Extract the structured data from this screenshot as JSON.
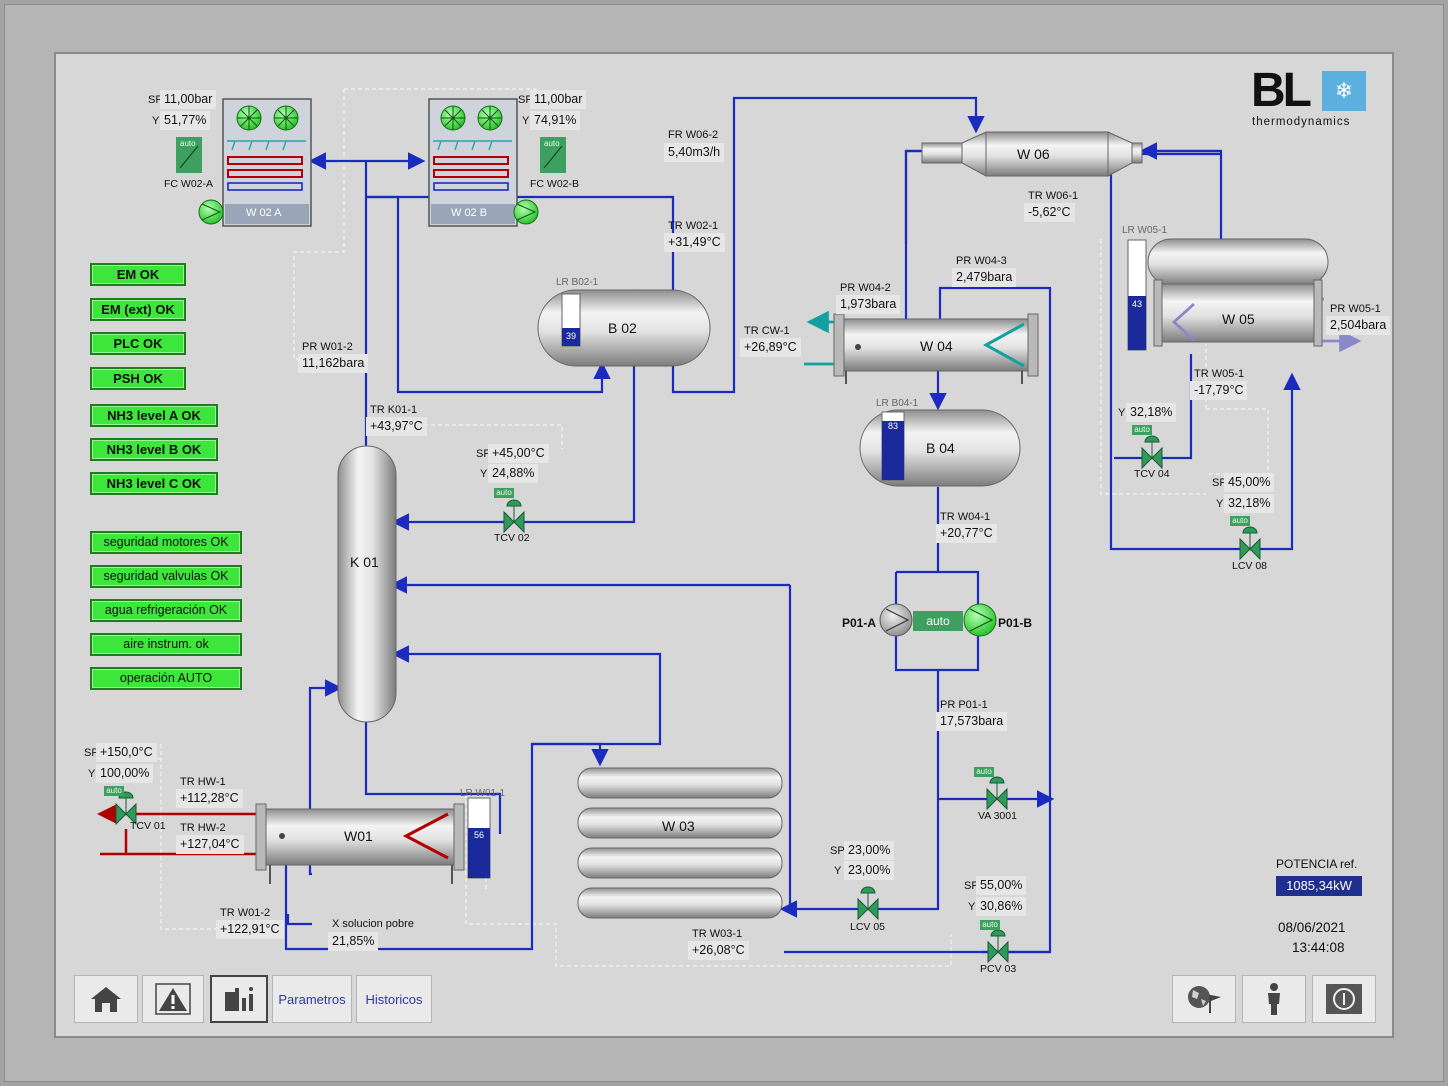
{
  "logo": {
    "letters": "BL",
    "subtitle": "thermodynamics"
  },
  "fans": {
    "w02a": {
      "name": "W 02 A",
      "sp_label": "SP",
      "sp": "11,00bar",
      "y_label": "Y",
      "y": "51,77%",
      "fc": "FC W02-A",
      "auto": "auto"
    },
    "w02b": {
      "name": "W 02 B",
      "sp_label": "SP",
      "sp": "11,00bar",
      "y_label": "Y",
      "y": "74,91%",
      "fc": "FC W02-B",
      "auto": "auto"
    }
  },
  "status": [
    "EM   OK",
    "EM (ext) OK",
    "PLC   OK",
    "PSH   OK",
    "NH3 level A OK",
    "NH3 level B OK",
    "NH3 level C OK"
  ],
  "status2": [
    "seguridad motores OK",
    "seguridad valvulas OK",
    "agua refrigeración OK",
    "aire instrum. ok",
    "operación AUTO"
  ],
  "vessels": {
    "b02": "B 02",
    "b04": "B 04",
    "w04": "W 04",
    "w05": "W 05",
    "w06": "W 06",
    "w01": "W01",
    "w03": "W 03",
    "k01": "K 01"
  },
  "levels": {
    "b02": {
      "tag": "LR B02-1",
      "value": "39"
    },
    "b04": {
      "tag": "LR B04-1",
      "value": "83"
    },
    "w05": {
      "tag": "LR W05-1",
      "value": "43"
    },
    "w01": {
      "tag": "LR W01-1",
      "value": "56"
    }
  },
  "tags": {
    "fr_w06_2": {
      "tag": "FR W06-2",
      "value": "5,40m3/h"
    },
    "tr_w02_1": {
      "tag": "TR W02-1",
      "value": "+31,49°C"
    },
    "tr_w06_1": {
      "tag": "TR W06-1",
      "value": "-5,62°C"
    },
    "pr_w01_2": {
      "tag": "PR W01-2",
      "value": "11,162bara"
    },
    "tr_k01_1": {
      "tag": "TR K01-1",
      "value": "+43,97°C"
    },
    "pr_w04_3": {
      "tag": "PR W04-3",
      "value": "2,479bara"
    },
    "pr_w04_2": {
      "tag": "PR W04-2",
      "value": "1,973bara"
    },
    "tr_cw_1": {
      "tag": "TR CW-1",
      "value": "+26,89°C"
    },
    "pr_w05_1": {
      "tag": "PR W05-1",
      "value": "2,504bara"
    },
    "tr_w05_1": {
      "tag": "TR W05-1",
      "value": "-17,79°C"
    },
    "tr_w04_1": {
      "tag": "TR W04-1",
      "value": "+20,77°C"
    },
    "pr_p01_1": {
      "tag": "PR P01-1",
      "value": "17,573bara"
    },
    "tr_hw_1": {
      "tag": "TR HW-1",
      "value": "+112,28°C"
    },
    "tr_hw_2": {
      "tag": "TR HW-2",
      "value": "+127,04°C"
    },
    "tr_w01_2": {
      "tag": "TR W01-2",
      "value": "+122,91°C"
    },
    "x_sol": {
      "tag": "X solucion pobre",
      "value": "21,85%"
    },
    "tr_w03_1": {
      "tag": "TR W03-1",
      "value": "+26,08°C"
    }
  },
  "valves": {
    "tcv02": {
      "name": "TCV 02",
      "sp_label": "SP",
      "sp": "+45,00°C",
      "y_label": "Y",
      "y": "24,88%",
      "auto": "auto"
    },
    "tcv04": {
      "name": "TCV 04",
      "y_label": "Y",
      "y": "32,18%",
      "auto": "auto"
    },
    "lcv08": {
      "name": "LCV 08",
      "sp_label": "SP",
      "sp": "45,00%",
      "y_label": "Y",
      "y": "32,18%",
      "auto": "auto"
    },
    "tcv01": {
      "name": "TCV 01",
      "sp_label": "SP",
      "sp": "+150,0°C",
      "y_label": "Y",
      "y": "100,00%",
      "auto": "auto"
    },
    "lcv05": {
      "name": "LCV 05",
      "sp_label": "SP",
      "sp": "23,00%",
      "y_label": "Y",
      "y": "23,00%"
    },
    "pcv03": {
      "name": "PCV 03",
      "sp_label": "SP",
      "sp": "55,00%",
      "y_label": "Y",
      "y": "30,86%",
      "auto": "auto"
    },
    "va3001": {
      "name": "VA 3001",
      "auto": "auto"
    }
  },
  "pumps": {
    "a": "P01-A",
    "b": "P01-B",
    "mode": "auto"
  },
  "potencia": {
    "label": "POTENCIA ref.",
    "value": "1085,34kW"
  },
  "date": "08/06/2021",
  "time": "13:44:08",
  "nav": {
    "parametros": "Parametros",
    "historicos": "Historicos"
  },
  "icons": [
    "home-icon",
    "alarm-warning-icon",
    "report-icon",
    "globe-icon",
    "user-icon",
    "power-icon"
  ],
  "colors": {
    "process_line": "#1b2bbf",
    "hot_line": "#b00000",
    "cooling_line": "#12a0a0",
    "status_green": "#3ee53a",
    "level_fill": "#1a2a9a"
  }
}
